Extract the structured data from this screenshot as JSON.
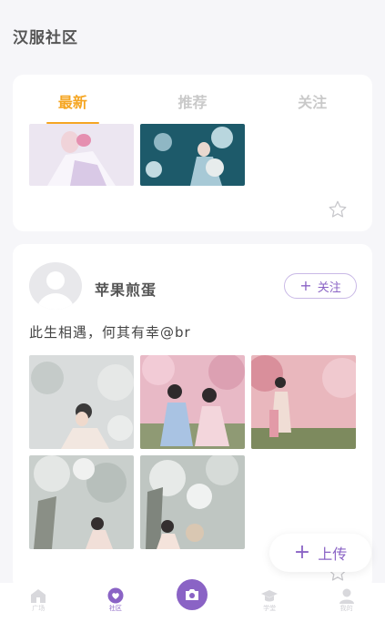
{
  "header": {
    "title": "汉服社区"
  },
  "tabs": [
    {
      "label": "最新",
      "active": true
    },
    {
      "label": "推荐",
      "active": false
    },
    {
      "label": "关注",
      "active": false
    }
  ],
  "post": {
    "username": "苹果煎蛋",
    "follow_label": "关注",
    "text": "此生相遇，何其有幸@br"
  },
  "upload": {
    "label": "上传"
  },
  "nav": [
    {
      "label": "广场",
      "icon": "home-icon"
    },
    {
      "label": "社区",
      "icon": "community-icon",
      "active": true
    },
    {
      "label": "",
      "icon": "camera-icon"
    },
    {
      "label": "学堂",
      "icon": "graduation-cap-icon"
    },
    {
      "label": "我的",
      "icon": "user-icon"
    }
  ],
  "colors": {
    "accent": "#f5a623",
    "brand": "#8a63c5",
    "background": "#f6f6f9"
  }
}
